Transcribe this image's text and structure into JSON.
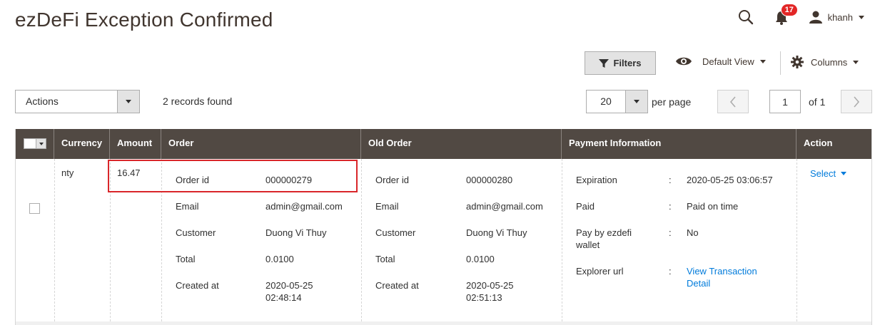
{
  "page": {
    "title": "ezDeFi Exception Confirmed"
  },
  "header": {
    "notifications_count": "17",
    "user_name": "khanh"
  },
  "toolbar": {
    "filters_label": "Filters",
    "view_label": "Default View",
    "columns_label": "Columns",
    "actions_label": "Actions",
    "records_found": "2 records found",
    "per_page_value": "20",
    "per_page_label": "per page",
    "current_page": "1",
    "of_pages": "of 1"
  },
  "grid": {
    "headers": {
      "currency": "Currency",
      "amount": "Amount",
      "order": "Order",
      "old_order": "Old Order",
      "payment": "Payment Information",
      "action": "Action"
    },
    "row": {
      "currency": "nty",
      "amount": "16.47",
      "order": {
        "order_id_label": "Order id",
        "order_id": "000000279",
        "email_label": "Email",
        "email": "admin@gmail.com",
        "customer_label": "Customer",
        "customer": "Duong Vi Thuy",
        "total_label": "Total",
        "total": "0.0100",
        "created_label": "Created at",
        "created_date": "2020-05-25",
        "created_time": "02:48:14"
      },
      "old_order": {
        "order_id_label": "Order id",
        "order_id": "000000280",
        "email_label": "Email",
        "email": "admin@gmail.com",
        "customer_label": "Customer",
        "customer": "Duong Vi Thuy",
        "total_label": "Total",
        "total": "0.0100",
        "created_label": "Created at",
        "created_date": "2020-05-25",
        "created_time": "02:51:13"
      },
      "payment": {
        "expiration_label": "Expiration",
        "expiration": "2020-05-25 03:06:57",
        "paid_label": "Paid",
        "paid": "Paid on time",
        "pay_by_label_1": "Pay by ezdefi",
        "pay_by_label_2": "wallet",
        "pay_by": "No",
        "explorer_label": "Explorer url",
        "explorer_link_1": "View Transaction",
        "explorer_link_2": "Detail",
        "colon": ":"
      },
      "action_label": "Select"
    }
  },
  "colors": {
    "header_bg": "#514943",
    "link": "#007bdb",
    "badge": "#e22626",
    "highlight": "#d9262a"
  }
}
